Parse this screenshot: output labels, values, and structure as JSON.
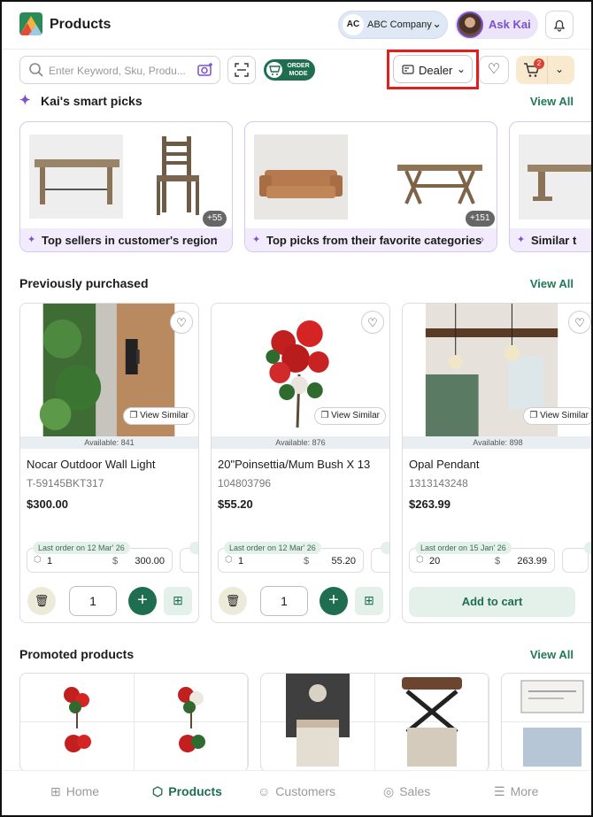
{
  "header": {
    "title": "Products",
    "company_initials": "AC",
    "company_name": "ABC Company",
    "ask_kai": "Ask Kai"
  },
  "toolbar": {
    "search_placeholder": "Enter Keyword, Sku, Produ...",
    "order_mode_line1": "ORDER",
    "order_mode_line2": "MODE",
    "dealer_label": "Dealer",
    "cart_count": "2"
  },
  "smart_picks": {
    "title": "Kai's smart picks",
    "view_all": "View All",
    "cards": [
      {
        "label": "Top sellers in customer's region",
        "more": "+55"
      },
      {
        "label": "Top picks from their favorite categories",
        "more": "+151"
      },
      {
        "label": "Similar t"
      }
    ]
  },
  "previously_purchased": {
    "title": "Previously purchased",
    "view_all": "View All",
    "view_similar": "View Similar",
    "products": [
      {
        "name": "Nocar Outdoor Wall Light",
        "sku": "T-59145BKT317",
        "price": "$300.00",
        "available": "Available: 841",
        "last_order": "Last order on 12 Mar' 26",
        "qty": "1",
        "currency": "$",
        "amount": "300.00",
        "cart_qty": "1"
      },
      {
        "name": "20\"Poinsettia/Mum Bush X 13",
        "sku": "104803796",
        "price": "$55.20",
        "available": "Available: 876",
        "last_order": "Last order on 12 Mar' 26",
        "qty": "1",
        "currency": "$",
        "amount": "55.20",
        "cart_qty": "1"
      },
      {
        "name": "Opal Pendant",
        "sku": "1313143248",
        "price": "$263.99",
        "available": "Available: 898",
        "last_order": "Last order on 15 Jan' 26",
        "qty": "20",
        "currency": "$",
        "amount": "263.99",
        "add_to_cart": "Add to cart"
      }
    ]
  },
  "promoted": {
    "title": "Promoted products",
    "view_all": "View All"
  },
  "nav": {
    "home": "Home",
    "products": "Products",
    "customers": "Customers",
    "sales": "Sales",
    "more": "More"
  },
  "colors": {
    "brand_green": "#1f6e4f",
    "accent_purple": "#7a4fd0",
    "highlight_red": "#e01f1f"
  }
}
